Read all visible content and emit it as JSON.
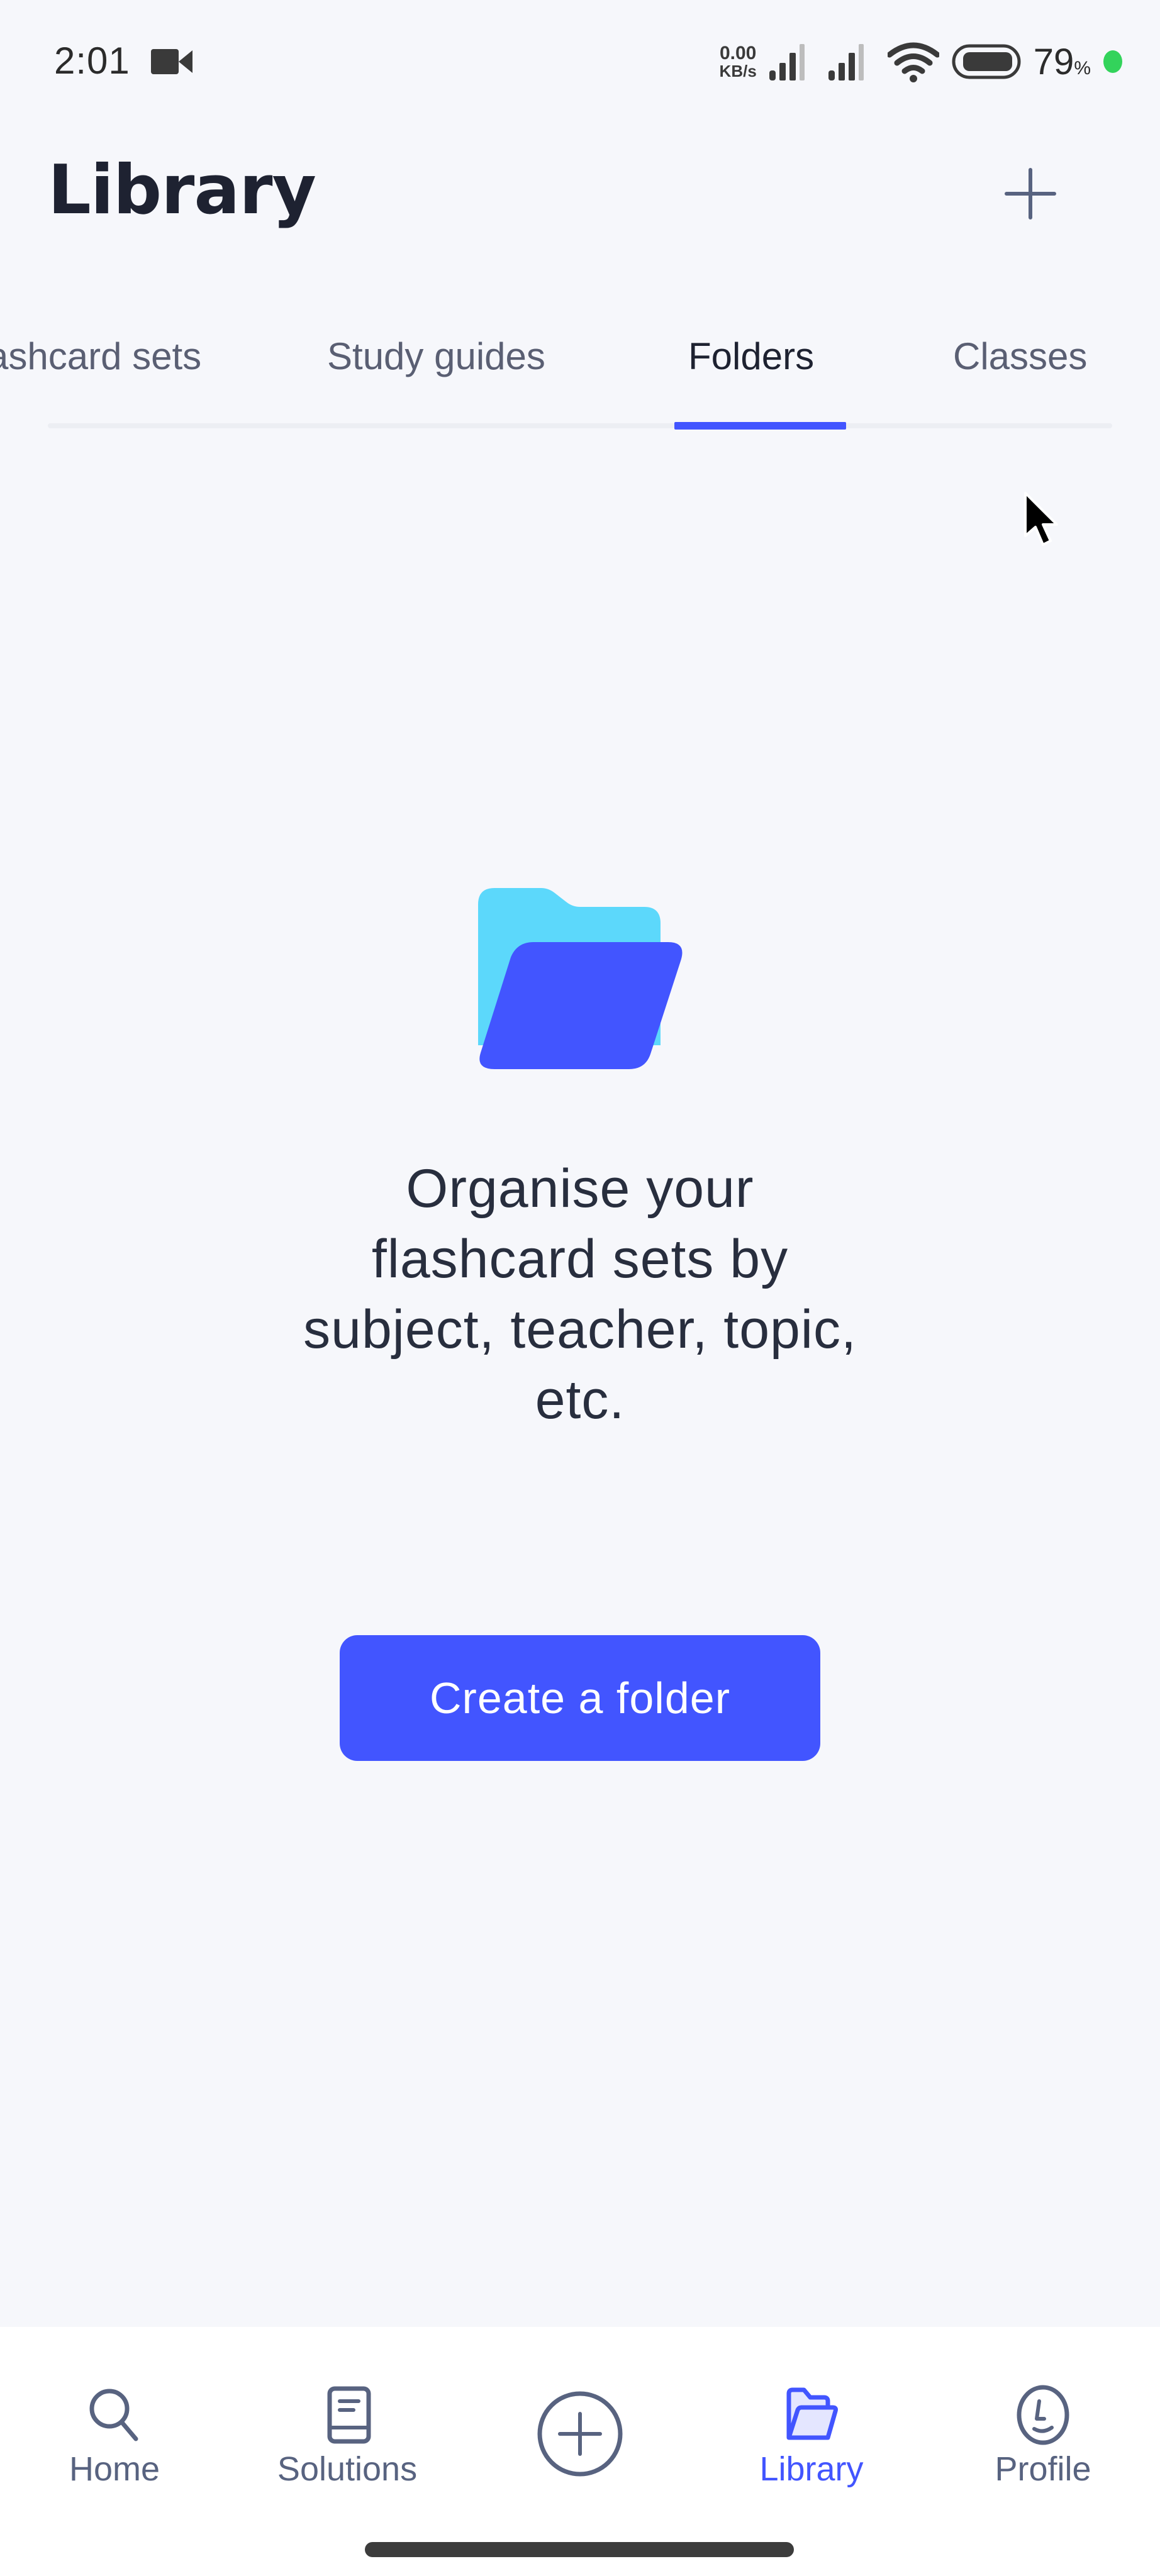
{
  "status_bar": {
    "time": "2:01",
    "net_speed_value": "0.00",
    "net_speed_unit": "KB/s",
    "battery_percent": "79",
    "battery_percent_sign": "%",
    "charging_color": "#33d35b"
  },
  "header": {
    "title": "Library",
    "add_button_icon": "plus-icon"
  },
  "tabs": [
    {
      "label": "Flashcard sets",
      "visible_label": "ashcard sets",
      "active": false
    },
    {
      "label": "Study guides",
      "active": false
    },
    {
      "label": "Folders",
      "active": true
    },
    {
      "label": "Classes",
      "active": false
    }
  ],
  "empty_state": {
    "illustration": "folder-illustration",
    "heading_lines": [
      "Organise your",
      "flashcard sets by",
      "subject, teacher, topic,",
      "etc."
    ],
    "button_label": "Create a folder"
  },
  "bottom_nav": {
    "items": [
      {
        "label": "Home",
        "icon": "search-icon",
        "active": false
      },
      {
        "label": "Solutions",
        "icon": "book-icon",
        "active": false
      },
      {
        "label": "",
        "icon": "plus-circle-icon",
        "active": false
      },
      {
        "label": "Library",
        "icon": "folder-icon",
        "active": true
      },
      {
        "label": "Profile",
        "icon": "profile-icon",
        "active": false
      }
    ]
  },
  "colors": {
    "accent": "#4255ff",
    "folder_back": "#5cd8fb",
    "background": "#f6f7fb",
    "text_primary": "#1e2231",
    "text_secondary": "#586380"
  }
}
